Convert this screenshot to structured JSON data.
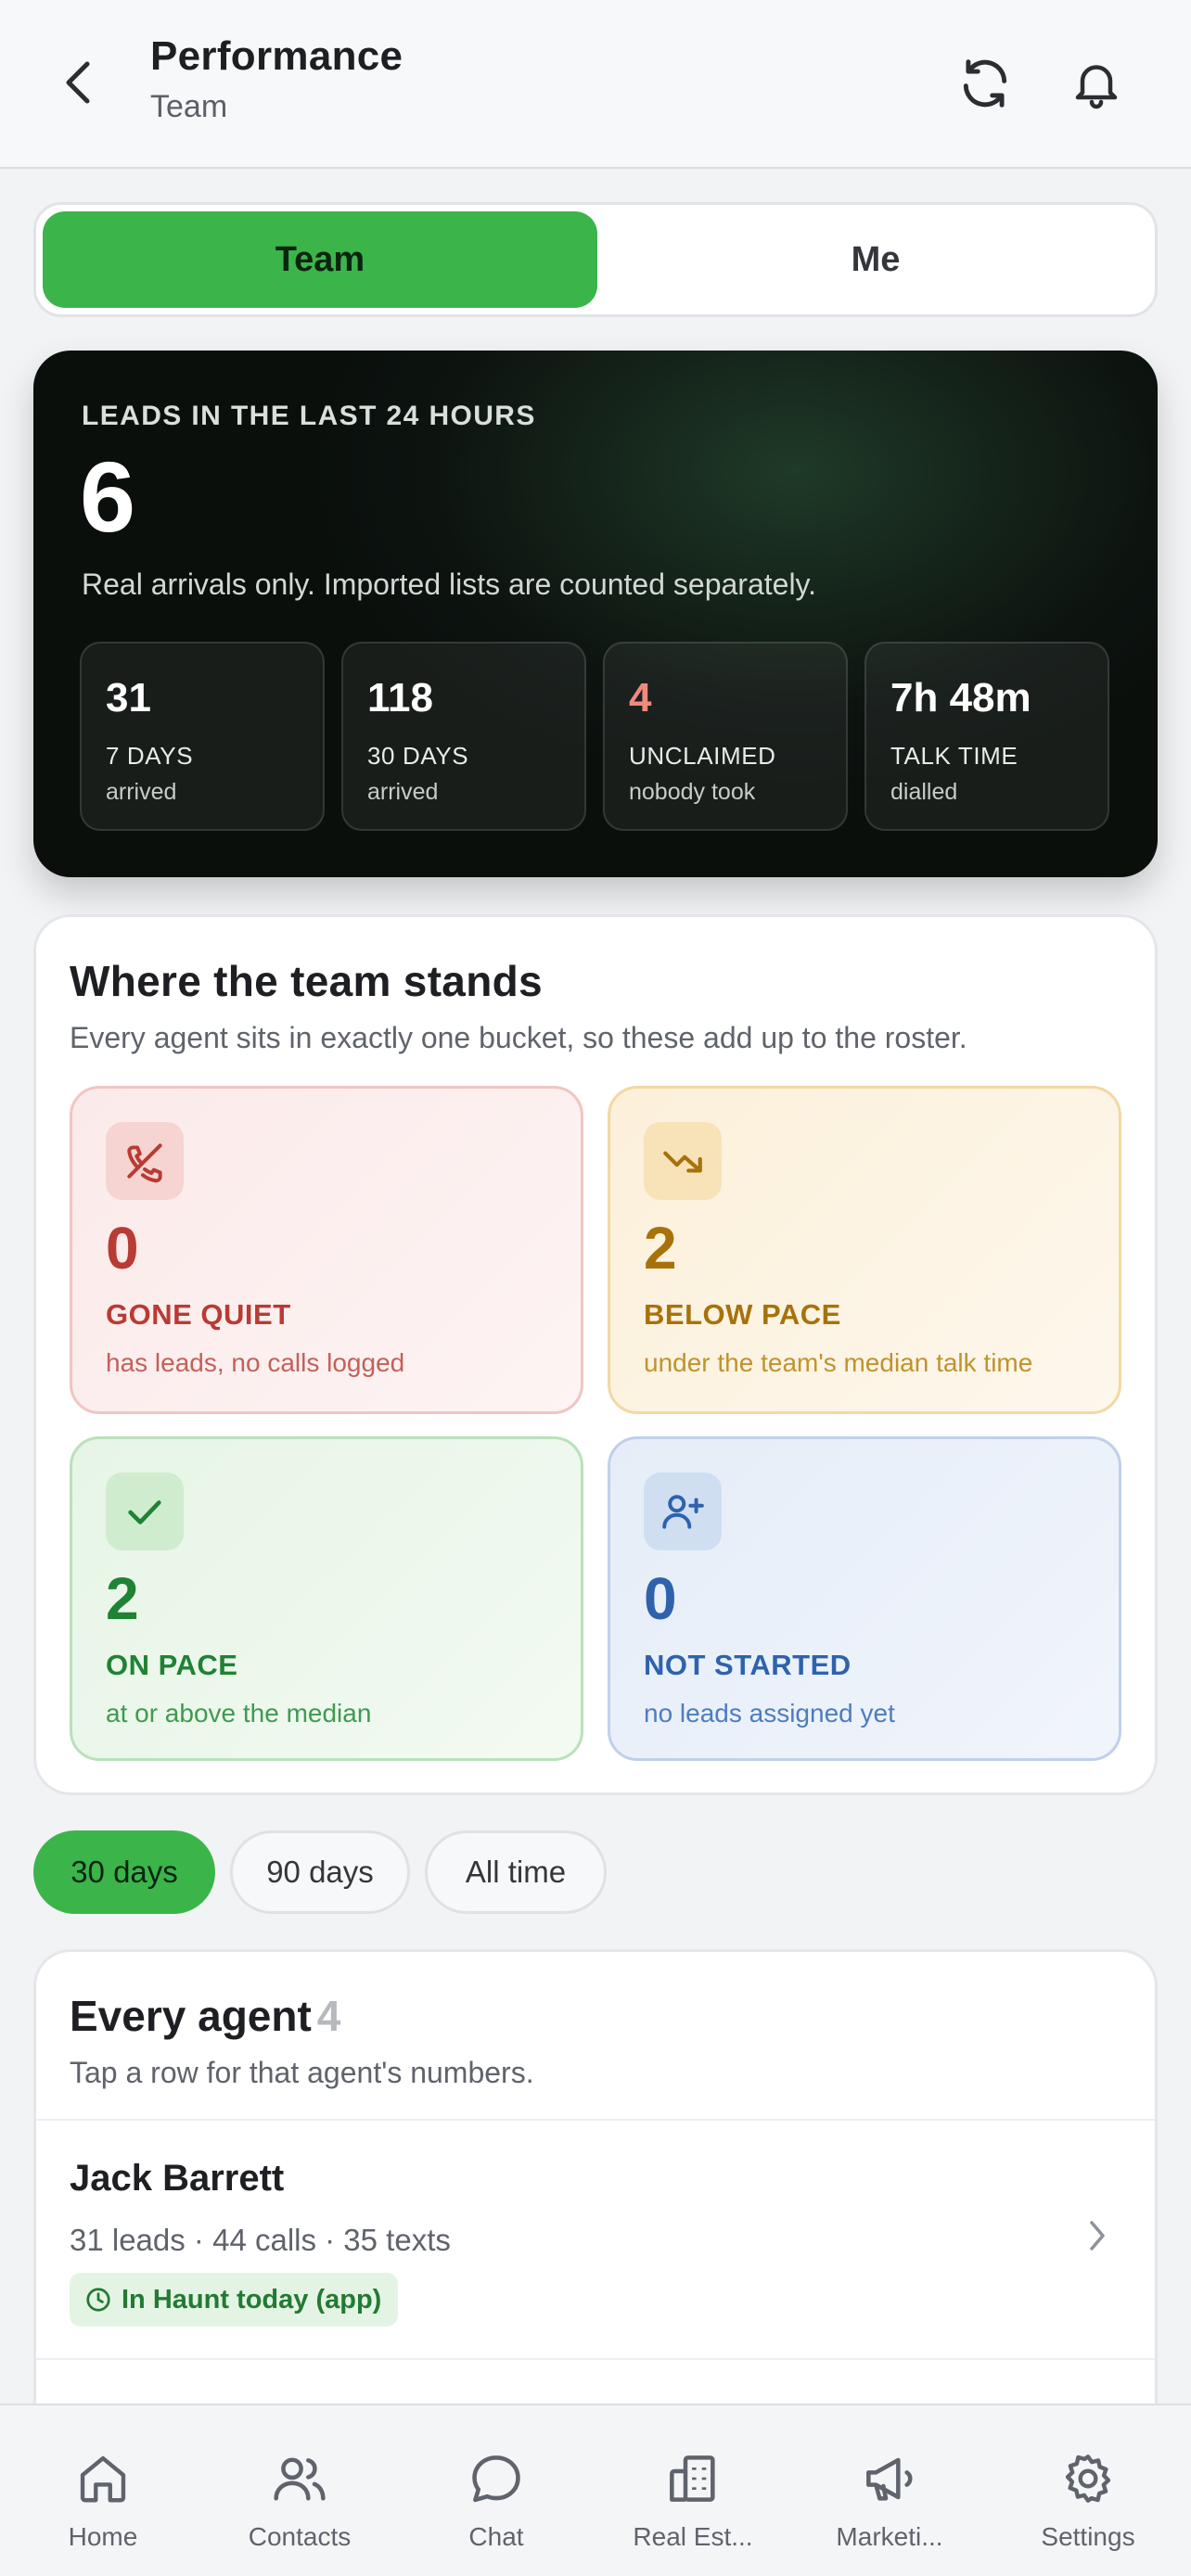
{
  "header": {
    "title": "Performance",
    "subtitle": "Team"
  },
  "segment": {
    "team": "Team",
    "me": "Me",
    "active": "Team"
  },
  "hero": {
    "label": "LEADS IN THE LAST 24 HOURS",
    "value": "6",
    "description": "Real arrivals only. Imported lists are counted separately.",
    "stats": [
      {
        "value": "31",
        "label": "7 DAYS",
        "sub": "arrived"
      },
      {
        "value": "118",
        "label": "30 DAYS",
        "sub": "arrived"
      },
      {
        "value": "4",
        "label": "UNCLAIMED",
        "sub": "nobody took"
      },
      {
        "value": "7h 48m",
        "label": "TALK TIME",
        "sub": "dialled"
      }
    ]
  },
  "stands": {
    "title": "Where the team stands",
    "subtitle": "Every agent sits in exactly one bucket, so these add up to the roster.",
    "buckets": [
      {
        "value": "0",
        "label": "GONE QUIET",
        "sub": "has leads, no calls logged",
        "icon": "phone-off-icon",
        "color": "#b83b34"
      },
      {
        "value": "2",
        "label": "BELOW PACE",
        "sub": "under the team's median talk time",
        "icon": "trending-down-icon",
        "color": "#a7720b"
      },
      {
        "value": "2",
        "label": "ON PACE",
        "sub": "at or above the median",
        "icon": "check-icon",
        "color": "#1f8234"
      },
      {
        "value": "0",
        "label": "NOT STARTED",
        "sub": "no leads assigned yet",
        "icon": "user-plus-icon",
        "color": "#2e62ad"
      }
    ]
  },
  "filters": [
    {
      "label": "30 days",
      "active": true
    },
    {
      "label": "90 days",
      "active": false
    },
    {
      "label": "All time",
      "active": false
    }
  ],
  "agents": {
    "title": "Every agent",
    "count": "4",
    "subtitle": "Tap a row for that agent's numbers.",
    "rows": [
      {
        "name": "Jack Barrett",
        "stats": "31 leads · 44 calls · 35 texts",
        "badge": "In Haunt today (app)"
      }
    ]
  },
  "tabbar": {
    "items": [
      {
        "label": "Home",
        "icon": "home-icon"
      },
      {
        "label": "Contacts",
        "icon": "contacts-icon"
      },
      {
        "label": "Chat",
        "icon": "chat-icon"
      },
      {
        "label": "Real Est...",
        "icon": "building-icon"
      },
      {
        "label": "Marketi...",
        "icon": "megaphone-icon"
      },
      {
        "label": "Settings",
        "icon": "gear-icon"
      }
    ]
  },
  "colors": {
    "accent": "#3bb54a",
    "hero_bg": "#0d1410",
    "warn": "#f08a7c"
  }
}
